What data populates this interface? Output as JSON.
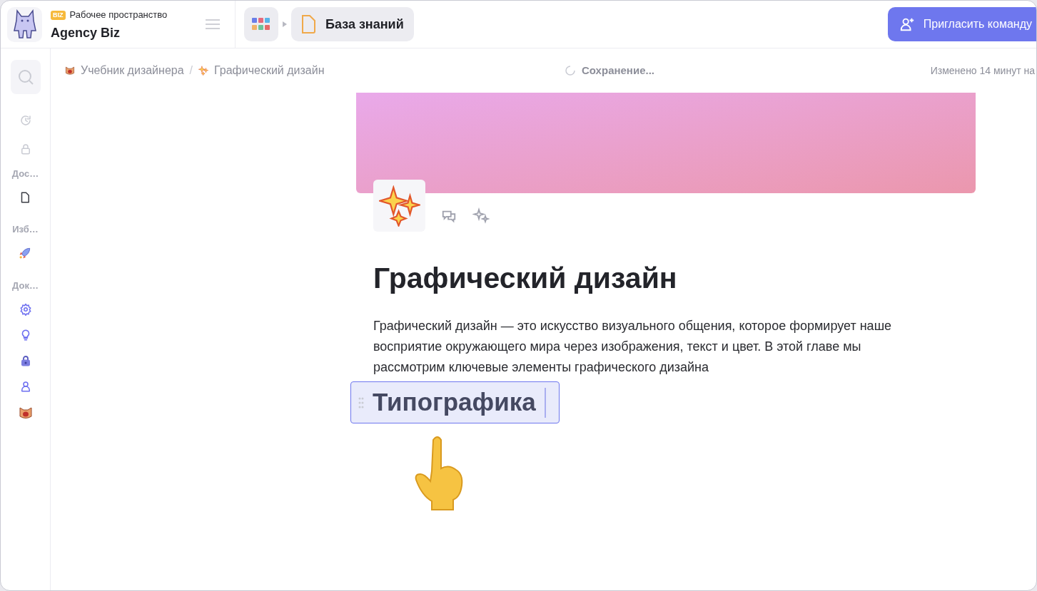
{
  "workspace": {
    "badge": "BIZ",
    "label": "Рабочее пространство",
    "name": "Agency Biz"
  },
  "top_crumb": {
    "title": "База знаний"
  },
  "invite_button": {
    "label": "Пригласить команду"
  },
  "sidebar": {
    "top_items": [
      {
        "kind": "history"
      },
      {
        "kind": "lock"
      }
    ],
    "sections": [
      {
        "label": "Дос…",
        "items": [
          {
            "kind": "document"
          }
        ]
      },
      {
        "label": "Изб…",
        "items": [
          {
            "kind": "rocket"
          }
        ]
      },
      {
        "label": "Док…",
        "items": [
          {
            "kind": "gear"
          },
          {
            "kind": "bulb"
          },
          {
            "kind": "padlock"
          },
          {
            "kind": "person"
          },
          {
            "kind": "cat"
          }
        ]
      }
    ]
  },
  "breadcrumbs": [
    {
      "label": "Учебник дизайнера",
      "kind": "cat"
    },
    {
      "label": "Графический дизайн",
      "kind": "sparkles"
    }
  ],
  "breadcrumb_separator": "/",
  "status": "Сохранение...",
  "modified": "Изменено 14 минут на",
  "document": {
    "title": "Графический дизайн",
    "paragraph": "Графический дизайн — это искусство визуального общения, которое формирует наше восприятие окружающего мира через изображения, текст и цвет. В этой главе мы рассмотрим ключевые элементы графического дизайна",
    "heading": {
      "text": "Типографика",
      "selected": true
    }
  }
}
